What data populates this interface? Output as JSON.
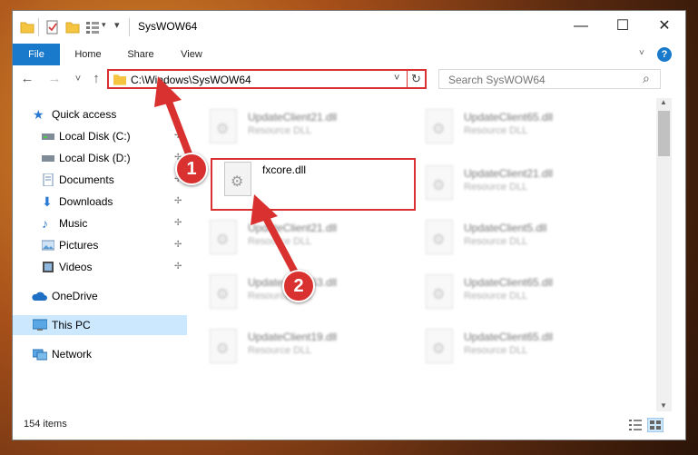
{
  "window": {
    "title": "SysWOW64",
    "minimize_glyph": "—",
    "maximize_glyph": "☐",
    "close_glyph": "✕"
  },
  "ribbon": {
    "tabs": [
      "File",
      "Home",
      "Share",
      "View"
    ],
    "help_glyph": "?"
  },
  "navigation": {
    "back_glyph": "←",
    "forward_glyph": "→",
    "recent_glyph": "˅",
    "up_glyph": "↑",
    "address": "C:\\Windows\\SysWOW64",
    "address_dropdown_glyph": "˅",
    "refresh_glyph": "↻",
    "search_placeholder": "Search SysWOW64",
    "search_icon_glyph": "⌕"
  },
  "sidebar": {
    "items": [
      {
        "label": "Quick access",
        "icon": "star-icon"
      },
      {
        "label": "Local Disk (C:)",
        "icon": "drive-icon"
      },
      {
        "label": "Local Disk (D:)",
        "icon": "drive-icon"
      },
      {
        "label": "Documents",
        "icon": "documents-icon"
      },
      {
        "label": "Downloads",
        "icon": "download-icon"
      },
      {
        "label": "Music",
        "icon": "music-icon"
      },
      {
        "label": "Pictures",
        "icon": "pictures-icon"
      },
      {
        "label": "Videos",
        "icon": "videos-icon"
      },
      {
        "label": "OneDrive",
        "icon": "cloud-icon"
      },
      {
        "label": "This PC",
        "icon": "computer-icon"
      },
      {
        "label": "Network",
        "icon": "network-icon"
      }
    ],
    "pin_glyph": "📌"
  },
  "files": {
    "left": [
      {
        "name": "UpdateClient21.dll",
        "type": "Resource DLL"
      },
      {
        "name": "fxcore.dll",
        "type": ""
      },
      {
        "name": "UpdateClient21.dll",
        "type": "Resource DLL"
      },
      {
        "name": "UpdateClient63.dll",
        "type": "Resource DLL"
      },
      {
        "name": "UpdateClient19.dll",
        "type": "Resource DLL"
      }
    ],
    "right": [
      {
        "name": "UpdateClient65.dll",
        "type": "Resource DLL"
      },
      {
        "name": "UpdateClient21.dll",
        "type": "Resource DLL"
      },
      {
        "name": "UpdateClient5.dll",
        "type": "Resource DLL"
      },
      {
        "name": "UpdateClient65.dll",
        "type": "Resource DLL"
      },
      {
        "name": "UpdateClient65.dll",
        "type": "Resource DLL"
      }
    ],
    "gear_glyph": "⚙"
  },
  "status": {
    "item_count": "154 items"
  },
  "annotations": {
    "step1": "1",
    "step2": "2"
  },
  "colors": {
    "accent": "#1979ca",
    "annotation_red": "#d9312f",
    "selection": "#cce8ff"
  }
}
